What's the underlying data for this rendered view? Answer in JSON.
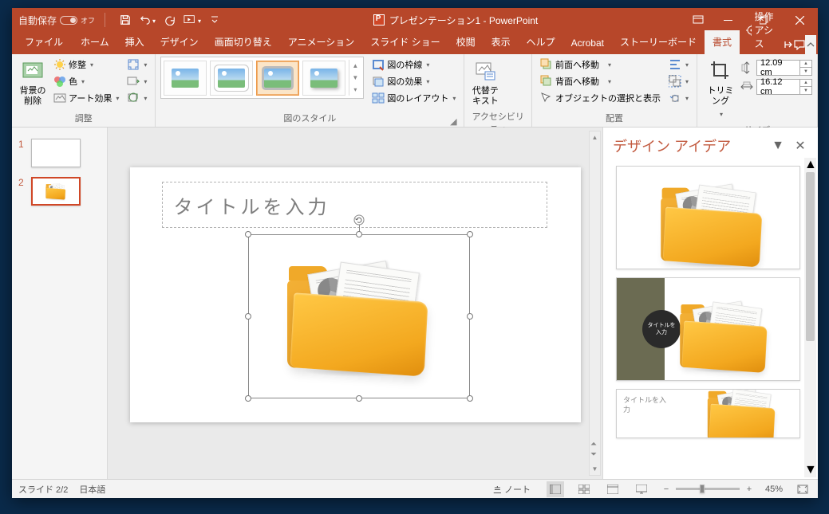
{
  "titlebar": {
    "autosave_label": "自動保存",
    "autosave_state": "オフ",
    "title": "プレゼンテーション1 - PowerPoint"
  },
  "tabs": {
    "file": "ファイル",
    "home": "ホーム",
    "insert": "挿入",
    "design": "デザイン",
    "transitions": "画面切り替え",
    "animations": "アニメーション",
    "slideshow": "スライド ショー",
    "review": "校閲",
    "view": "表示",
    "help": "ヘルプ",
    "acrobat": "Acrobat",
    "storyboard": "ストーリーボード",
    "format": "書式",
    "tell_me": "操作アシス"
  },
  "ribbon": {
    "group_adjust": "調整",
    "remove_bg": "背景の\n削除",
    "corrections": "修整",
    "color": "色",
    "artistic": "アート効果",
    "group_styles": "図のスタイル",
    "border": "図の枠線",
    "effects": "図の効果",
    "layout": "図のレイアウト",
    "group_acc": "アクセシビリティ",
    "alt_text": "代替テ\nキスト",
    "group_arrange": "配置",
    "bring_forward": "前面へ移動",
    "send_backward": "背面へ移動",
    "selection_pane": "オブジェクトの選択と表示",
    "group_size": "サイズ",
    "crop": "トリミング",
    "height_value": "12.09 cm",
    "width_value": "16.12 cm"
  },
  "thumbnails": [
    {
      "num": "1",
      "selected": false
    },
    {
      "num": "2",
      "selected": true
    }
  ],
  "slide": {
    "title_placeholder": "タイトルを入力"
  },
  "design_pane": {
    "title": "デザイン アイデア",
    "idea2_badge": "タイトルを\n入力",
    "idea3_text": "タイトルを入\n力"
  },
  "status": {
    "slide_indicator": "スライド 2/2",
    "language": "日本語",
    "notes": "ノート",
    "zoom_pct": "45%"
  }
}
